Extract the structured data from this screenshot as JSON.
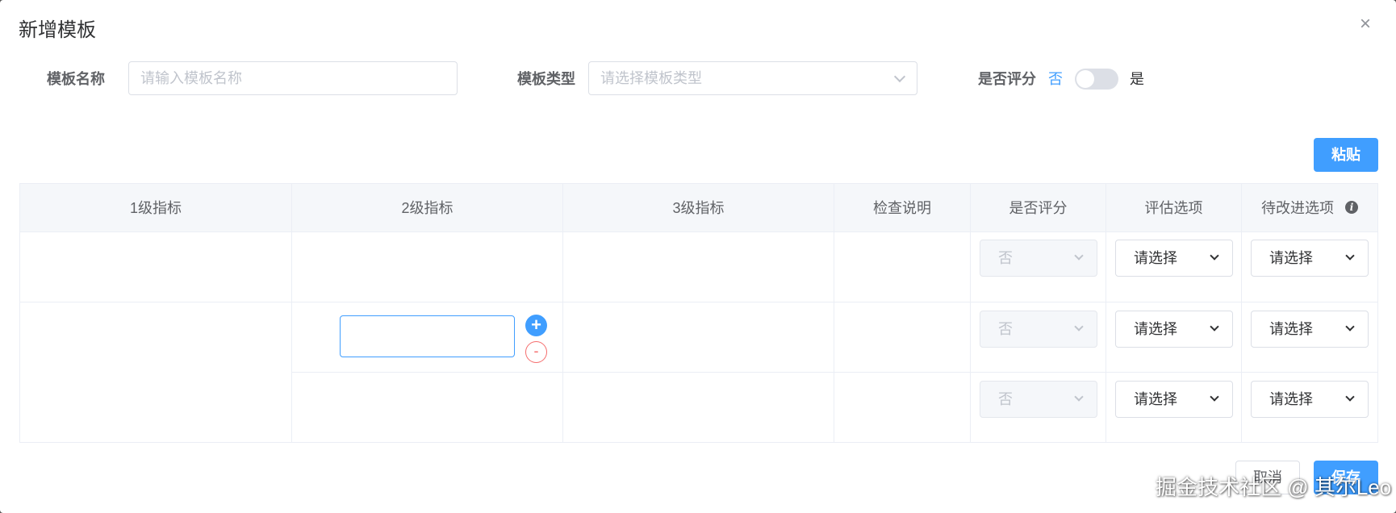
{
  "dialog": {
    "title": "新增模板",
    "close_icon": "×"
  },
  "form": {
    "name_label": "模板名称",
    "name_placeholder": "请输入模板名称",
    "type_label": "模板类型",
    "type_placeholder": "请选择模板类型",
    "score_label": "是否评分",
    "score_off": "否",
    "score_on": "是",
    "score_enabled": false
  },
  "toolbar": {
    "paste_label": "粘贴"
  },
  "table": {
    "headers": [
      "1级指标",
      "2级指标",
      "3级指标",
      "检查说明",
      "是否评分",
      "评估选项",
      "待改进选项"
    ],
    "info_icon": "i",
    "rows": [
      {
        "score": "否",
        "eval": "请选择",
        "improve": "请选择"
      },
      {
        "score": "否",
        "eval": "请选择",
        "improve": "请选择"
      },
      {
        "score": "否",
        "eval": "请选择",
        "improve": "请选择"
      }
    ],
    "add_symbol": "+",
    "remove_symbol": "-"
  },
  "footer": {
    "cancel_label": "取消",
    "save_label": "保存"
  },
  "watermark": "掘金技术社区 @ 其尔Leo",
  "colors": {
    "primary": "#409eff",
    "danger": "#f56c6c",
    "border": "#dcdfe6",
    "header_bg": "#f5f7fa"
  }
}
